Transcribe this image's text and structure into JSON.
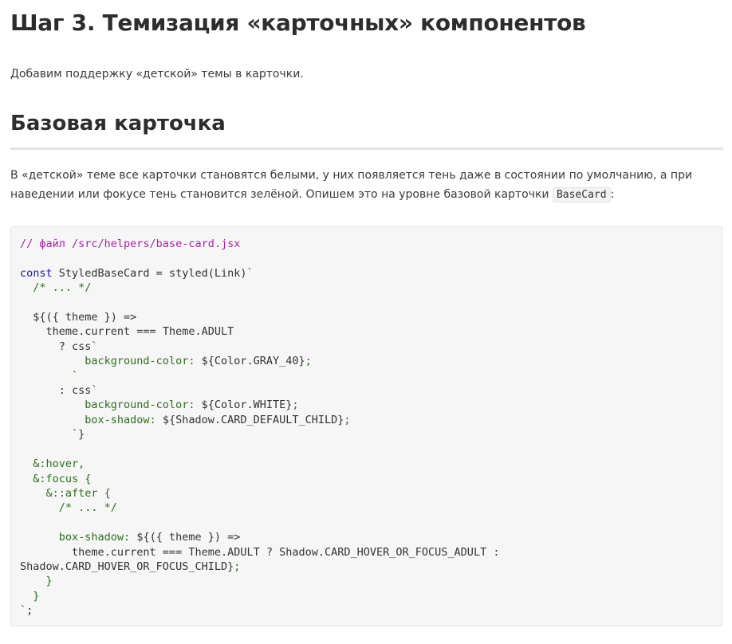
{
  "heading": "Шаг 3. Темизация «карточных» компонентов",
  "intro": "Добавим поддержку «детской» темы в карточки.",
  "section": {
    "title": "Базовая карточка",
    "paragraph_before": "В «детской» теме все карточки становятся белыми, у них появляется тень даже в состоянии по умолчанию, а при наведении или фокусе тень становится зелёной. Опишем это на уровне базовой карточки ",
    "inline_code": "BaseCard",
    "paragraph_after": ":"
  },
  "code": {
    "language": "jsx",
    "lines": [
      [
        {
          "t": "comment",
          "v": "// файл /src/helpers/base-card.jsx"
        }
      ],
      [],
      [
        {
          "t": "keyword",
          "v": "const"
        },
        {
          "t": "plain",
          "v": " StyledBaseCard = styled(Link)"
        },
        {
          "t": "string",
          "v": "`"
        }
      ],
      [
        {
          "t": "string",
          "v": "  /* ... */"
        }
      ],
      [],
      [
        {
          "t": "string",
          "v": "  "
        },
        {
          "t": "plain",
          "v": "${({ theme }) =>"
        }
      ],
      [
        {
          "t": "string",
          "v": "    "
        },
        {
          "t": "plain",
          "v": "theme.current === Theme.ADULT"
        }
      ],
      [
        {
          "t": "plain",
          "v": "      ? css"
        },
        {
          "t": "string",
          "v": "`"
        }
      ],
      [
        {
          "t": "string",
          "v": "          background-color: "
        },
        {
          "t": "plain",
          "v": "${Color.GRAY_40}"
        },
        {
          "t": "string",
          "v": ";"
        }
      ],
      [
        {
          "t": "string",
          "v": "        `"
        }
      ],
      [
        {
          "t": "plain",
          "v": "      : css"
        },
        {
          "t": "string",
          "v": "`"
        }
      ],
      [
        {
          "t": "string",
          "v": "          background-color: "
        },
        {
          "t": "plain",
          "v": "${Color.WHITE}"
        },
        {
          "t": "string",
          "v": ";"
        }
      ],
      [
        {
          "t": "string",
          "v": "          box-shadow: "
        },
        {
          "t": "plain",
          "v": "${Shadow.CARD_DEFAULT_CHILD}"
        },
        {
          "t": "string",
          "v": ";"
        }
      ],
      [
        {
          "t": "string",
          "v": "        `"
        },
        {
          "t": "plain",
          "v": "}"
        }
      ],
      [],
      [
        {
          "t": "string",
          "v": "  &:hover,"
        }
      ],
      [
        {
          "t": "string",
          "v": "  &:focus {"
        }
      ],
      [
        {
          "t": "string",
          "v": "    &::after {"
        }
      ],
      [
        {
          "t": "string",
          "v": "      /* ... */"
        }
      ],
      [],
      [
        {
          "t": "string",
          "v": "      box-shadow: "
        },
        {
          "t": "plain",
          "v": "${({ theme }) =>"
        }
      ],
      [
        {
          "t": "plain",
          "v": "        theme.current === Theme.ADULT ? Shadow.CARD_HOVER_OR_FOCUS_ADULT :"
        }
      ],
      [
        {
          "t": "plain",
          "v": "Shadow.CARD_HOVER_OR_FOCUS_CHILD}"
        },
        {
          "t": "string",
          "v": ";"
        }
      ],
      [
        {
          "t": "string",
          "v": "    }"
        }
      ],
      [
        {
          "t": "string",
          "v": "  }"
        }
      ],
      [
        {
          "t": "string",
          "v": "`"
        },
        {
          "t": "plain",
          "v": ";"
        }
      ]
    ]
  },
  "colors": {
    "comment": "#a626a4",
    "keyword": "#1a1aa6",
    "string": "#2f6e20",
    "plain": "#333333",
    "code_background": "#f6f6f6"
  }
}
